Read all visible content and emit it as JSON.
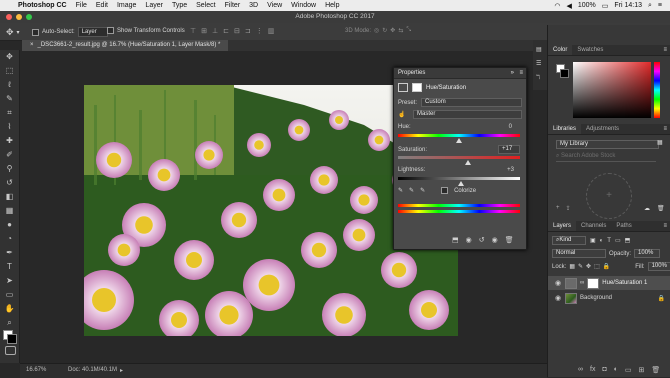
{
  "menubar": {
    "apple": "",
    "app": "Photoshop CC",
    "items": [
      "File",
      "Edit",
      "Image",
      "Layer",
      "Type",
      "Select",
      "Filter",
      "3D",
      "View",
      "Window",
      "Help"
    ],
    "battery": "100%",
    "clock": "Fri 14:13"
  },
  "window_title": "Adobe Photoshop CC 2017",
  "options": {
    "auto_select_label": "Auto-Select:",
    "auto_select_value": "Layer",
    "show_transform": "Show Transform Controls",
    "mode3d": "3D Mode:"
  },
  "document_tab": "_DSC3661-2_result.jpg @ 16.7% (Hue/Saturation 1, Layer Mask/8) *",
  "status": {
    "zoom": "16.67%",
    "doc": "Doc: 40.1M/40.1M"
  },
  "properties": {
    "title": "Properties",
    "subtitle": "Hue/Saturation",
    "preset_label": "Preset:",
    "preset_value": "Custom",
    "channel_value": "Master",
    "hue_label": "Hue:",
    "hue_value": "0",
    "saturation_label": "Saturation:",
    "saturation_value": "+17",
    "lightness_label": "Lightness:",
    "lightness_value": "+3",
    "colorize_label": "Colorize"
  },
  "color_panel": {
    "tabs": [
      "Color",
      "Swatches"
    ],
    "accent": "#e12a2a"
  },
  "libraries_panel": {
    "tabs": [
      "Libraries",
      "Adjustments"
    ],
    "library": "My Library",
    "search_placeholder": "Search Adobe Stock"
  },
  "layers_panel": {
    "tabs": [
      "Layers",
      "Channels",
      "Paths"
    ],
    "kind": "Kind",
    "blend_mode": "Normal",
    "opacity_label": "Opacity:",
    "opacity_value": "100%",
    "lock_label": "Lock:",
    "fill_label": "Fill:",
    "fill_value": "100%",
    "layers": [
      {
        "name": "Hue/Saturation 1"
      },
      {
        "name": "Background"
      }
    ]
  }
}
